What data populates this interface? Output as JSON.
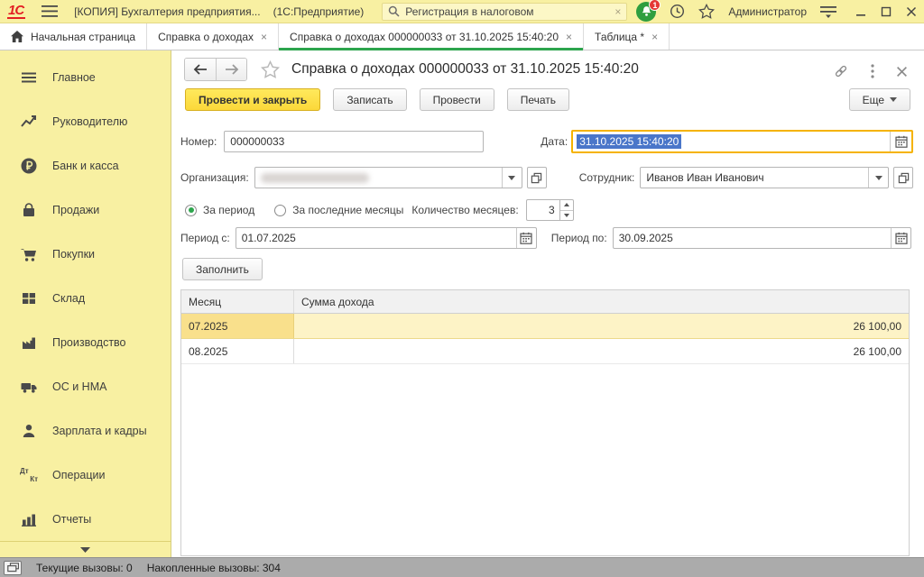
{
  "topbar": {
    "logo_text": "1С",
    "app_title": "[КОПИЯ] Бухгалтерия предприятия...",
    "app_kind": "(1С:Предприятие)",
    "search_value": "Регистрация в налоговом",
    "notifications_badge": "1",
    "user_name": "Администратор"
  },
  "tabbar": {
    "tabs": [
      {
        "label": "Начальная страница"
      },
      {
        "label": "Справка о доходах"
      },
      {
        "label": "Справка о доходах 000000033 от 31.10.2025 15:40:20"
      },
      {
        "label": "Таблица *"
      }
    ]
  },
  "sidebar": {
    "items": [
      {
        "label": "Главное"
      },
      {
        "label": "Руководителю"
      },
      {
        "label": "Банк и касса"
      },
      {
        "label": "Продажи"
      },
      {
        "label": "Покупки"
      },
      {
        "label": "Склад"
      },
      {
        "label": "Производство"
      },
      {
        "label": "ОС и НМА"
      },
      {
        "label": "Зарплата и кадры"
      },
      {
        "label": "Операции"
      },
      {
        "label": "Отчеты"
      }
    ],
    "operations_icon_top": "Дт",
    "operations_icon_bottom": "Кт"
  },
  "document": {
    "title": "Справка о доходах 000000033 от 31.10.2025 15:40:20",
    "toolbar": {
      "post_and_close": "Провести и закрыть",
      "write": "Записать",
      "post": "Провести",
      "print": "Печать",
      "more": "Еще"
    },
    "fields": {
      "number_label": "Номер:",
      "number_value": "000000033",
      "date_label": "Дата:",
      "date_value": "31.10.2025 15:40:20",
      "organization_label": "Организация:",
      "employee_label": "Сотрудник:",
      "employee_value": "Иванов Иван Иванович",
      "period_radio_label": "За период",
      "last_months_radio_label": "За последние месяцы",
      "months_count_label": "Количество месяцев:",
      "months_count_value": "3",
      "period_from_label": "Период с:",
      "period_from_value": "01.07.2025",
      "period_to_label": "Период по:",
      "period_to_value": "30.09.2025",
      "fill_button": "Заполнить"
    },
    "table": {
      "columns": [
        {
          "label": "Месяц"
        },
        {
          "label": "Сумма дохода"
        }
      ],
      "rows": [
        {
          "month": "07.2025",
          "amount": "26 100,00"
        },
        {
          "month": "08.2025",
          "amount": "26 100,00"
        }
      ]
    }
  },
  "statusbar": {
    "current_calls": "Текущие вызовы: 0",
    "accumulated_calls": "Накопленные вызовы: 304"
  },
  "colors": {
    "panel_yellow": "#f8f0a2",
    "accent_green": "#2da54d",
    "primary_button_yellow": "#fbd83a",
    "focus_border": "#f5b300",
    "selection_blue": "#4a76c9",
    "logo_red": "#e31e24",
    "selected_row": "#fdf3c6",
    "selected_cell": "#f9e08c",
    "statusbar_gray": "#ababab"
  }
}
